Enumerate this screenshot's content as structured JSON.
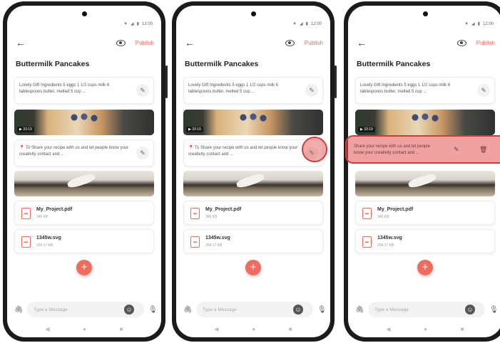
{
  "status": {
    "time": "12:00"
  },
  "header": {
    "back_icon": "arrow-left-icon",
    "preview_icon": "eye-icon",
    "publish_label": "Publish"
  },
  "recipe_title": "Buttermilk Pancakes",
  "ingredients_text": "Lovely Gift Ingredients 5 eggs 1 1/2 cups milk 6 tablespoons butter, melted 5 cup ...",
  "video": {
    "duration": "▶ 33:19"
  },
  "share_note": {
    "text": "To Share your recipe with us and let people know your creativity contact and ..."
  },
  "share_note_swiped_text": "Share your recipe with us and let people know your creativity contact and ...",
  "files": [
    {
      "name": "My_Project.pdf",
      "size": "345 KB"
    },
    {
      "name": "1345w.svg",
      "size": "254.17 KB"
    }
  ],
  "composer": {
    "placeholder": "Type a Message"
  },
  "colors": {
    "accent": "#ef6b5e",
    "highlight": "#e45555"
  },
  "icons": [
    "edit-icon",
    "delete-icon",
    "attach-icon",
    "emoji-icon",
    "mic-icon",
    "plus-icon"
  ]
}
